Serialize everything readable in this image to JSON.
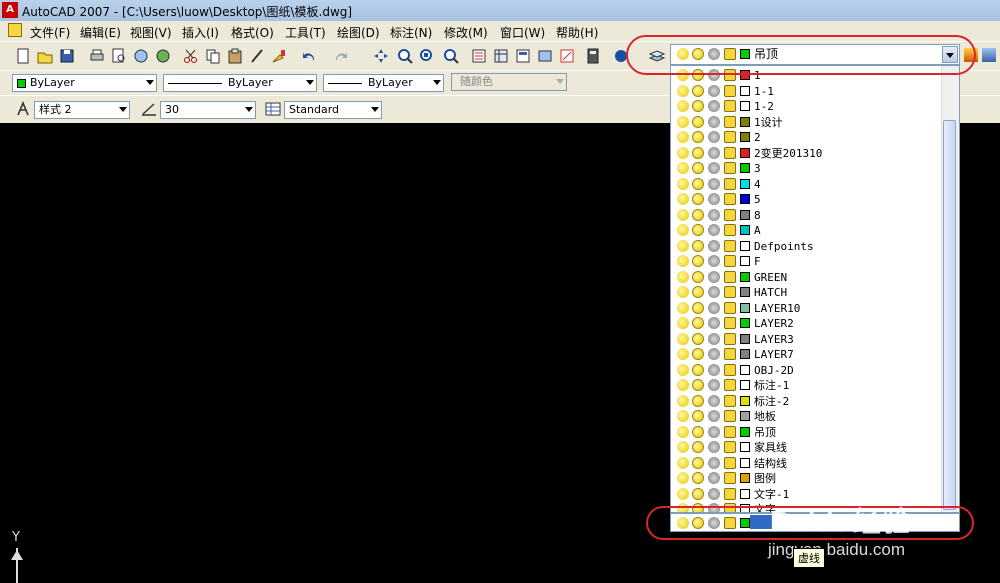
{
  "window": {
    "title": "AutoCAD 2007 - [C:\\Users\\luow\\Desktop\\图纸\\模板.dwg]"
  },
  "menu": [
    "文件(F)",
    "编辑(E)",
    "视图(V)",
    "插入(I)",
    "格式(O)",
    "工具(T)",
    "绘图(D)",
    "标注(N)",
    "修改(M)",
    "窗口(W)",
    "帮助(H)"
  ],
  "properties": {
    "color": "ByLayer",
    "linetype": "ByLayer",
    "lineweight": "ByLayer",
    "plotstyle": "随颜色"
  },
  "styles": {
    "text_style": "样式 2",
    "dim_value": "30",
    "table_style": "Standard"
  },
  "layer_combo": {
    "current": "吊顶",
    "current_color": "#00cc00"
  },
  "layers": [
    {
      "name": "1",
      "color": "#e02020"
    },
    {
      "name": "1-1",
      "color": "#ffffff"
    },
    {
      "name": "1-2",
      "color": "#ffffff"
    },
    {
      "name": "1设计",
      "color": "#808000"
    },
    {
      "name": "2",
      "color": "#808000"
    },
    {
      "name": "2变更201310",
      "color": "#e02020"
    },
    {
      "name": "3",
      "color": "#00cc00"
    },
    {
      "name": "4",
      "color": "#00e0e0"
    },
    {
      "name": "5",
      "color": "#0000e0"
    },
    {
      "name": "8",
      "color": "#808080"
    },
    {
      "name": "A",
      "color": "#00c0c0"
    },
    {
      "name": "Defpoints",
      "color": "#ffffff"
    },
    {
      "name": "F",
      "color": "#ffffff"
    },
    {
      "name": "GREEN",
      "color": "#00cc00"
    },
    {
      "name": "HATCH",
      "color": "#808080"
    },
    {
      "name": "LAYER10",
      "color": "#7fbf9f"
    },
    {
      "name": "LAYER2",
      "color": "#00cc00"
    },
    {
      "name": "LAYER3",
      "color": "#808080"
    },
    {
      "name": "LAYER7",
      "color": "#808080"
    },
    {
      "name": "OBJ-2D",
      "color": "#ffffff"
    },
    {
      "name": "标注-1",
      "color": "#ffffff"
    },
    {
      "name": "标注-2",
      "color": "#e0e000"
    },
    {
      "name": "地板",
      "color": "#a0a0a0"
    },
    {
      "name": "吊顶",
      "color": "#00cc00"
    },
    {
      "name": "家具线",
      "color": "#ffffff"
    },
    {
      "name": "结构线",
      "color": "#ffffff"
    },
    {
      "name": "图例",
      "color": "#e0a000"
    },
    {
      "name": "文字-1",
      "color": "#ffffff"
    },
    {
      "name": "文字",
      "color": "#ffffff"
    }
  ],
  "bottom_row": {
    "color": "#00cc00"
  },
  "watermark": {
    "logo": "Baidu经验",
    "url": "jingyan.baidu.com"
  },
  "tooltip": "虚线",
  "ucs": {
    "y_label": "Y"
  }
}
